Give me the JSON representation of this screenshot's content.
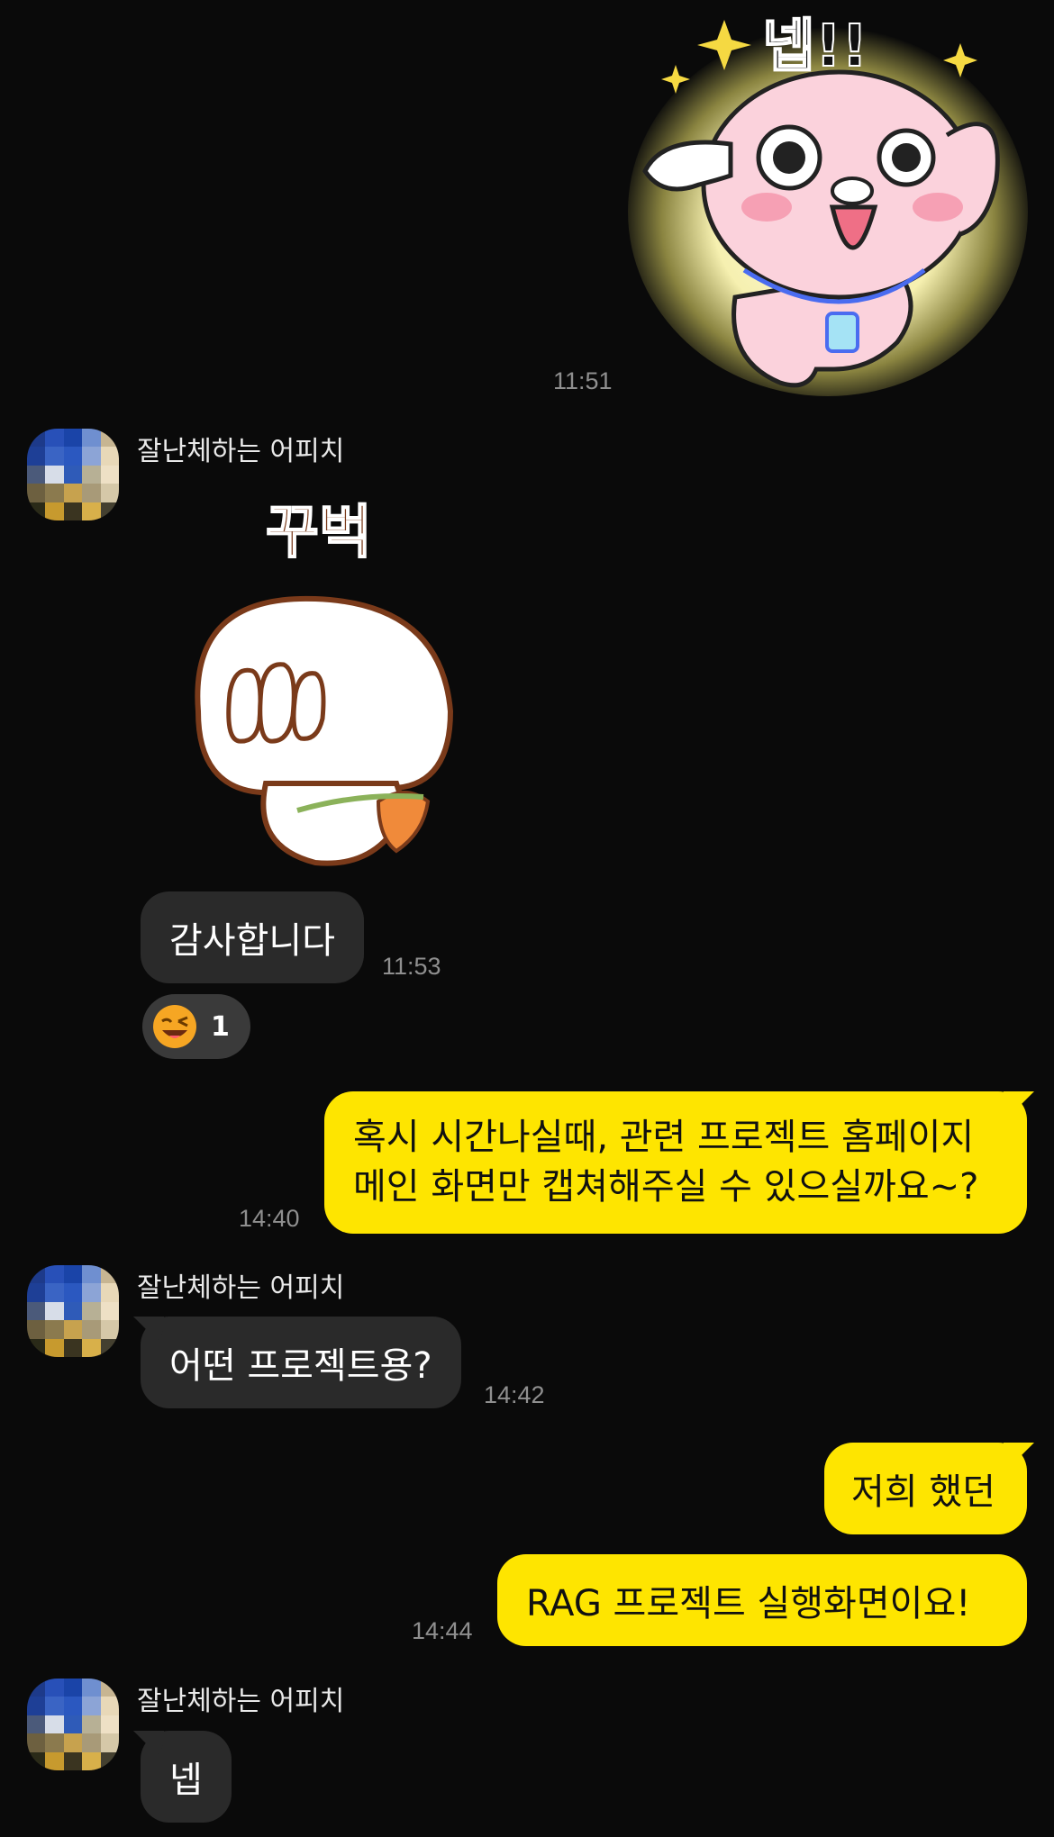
{
  "messages": [
    {
      "time": "11:51"
    },
    {
      "sender": "잘난체하는 어피치",
      "text": "감사합니다",
      "time": "11:53",
      "reaction": {
        "count": "1"
      }
    },
    {
      "text_lines": [
        "혹시 시간나실때, 관련 프로젝트 홈페이지",
        "메인 화면만 캡쳐해주실 수 있으실까요~?"
      ],
      "time": "14:40"
    },
    {
      "sender": "잘난체하는 어피치",
      "text": "어떤 프로젝트용?",
      "time": "14:42"
    },
    {
      "text": "저희 했던"
    },
    {
      "text": "RAG 프로젝트 실행화면이요!",
      "time": "14:44"
    },
    {
      "sender": "잘난체하는 어피치",
      "text": "넵"
    }
  ],
  "stickers": {
    "top": {
      "caption": "넵!!"
    },
    "middle": {
      "caption": "꾸벅"
    }
  },
  "colors": {
    "background": "#0a0a0a",
    "incoming_bubble": "#2a2a2a",
    "outgoing_bubble": "#fee500"
  }
}
